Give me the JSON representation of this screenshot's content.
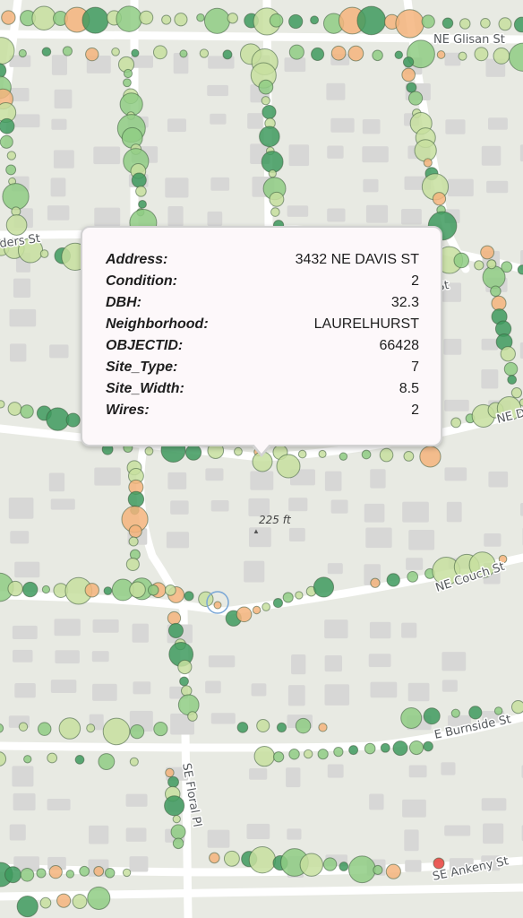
{
  "streets": {
    "glisan": "NE Glisan St",
    "flanders_partial": "ders St",
    "davis_partial_1": "s St",
    "davis_partial_2": "NE Da",
    "couch": "NE Couch St",
    "burnside": "E Burnside St",
    "floral": "SE Floral Pl",
    "ankeny": "SE Ankeny St"
  },
  "popup": {
    "fields": [
      {
        "key": "Address:",
        "value": "3432 NE DAVIS ST"
      },
      {
        "key": "Condition:",
        "value": "2"
      },
      {
        "key": "DBH:",
        "value": "32.3"
      },
      {
        "key": "Neighborhood:",
        "value": "LAURELHURST"
      },
      {
        "key": "OBJECTID:",
        "value": "66428"
      },
      {
        "key": "Site_Type:",
        "value": "7"
      },
      {
        "key": "Site_Width:",
        "value": "8.5"
      },
      {
        "key": "Wires:",
        "value": "2"
      }
    ]
  },
  "scale": {
    "label": "225 ft",
    "marker": "▲"
  },
  "colors": {
    "tree_light": "#c7df9f",
    "tree_mid": "#8fcc84",
    "tree_dark": "#3e9a5e",
    "tree_orange": "#f5b47c",
    "tree_red": "#e8413c",
    "road": "#ffffff",
    "block": "#e6e8e1",
    "building": "#d7d7d6"
  }
}
